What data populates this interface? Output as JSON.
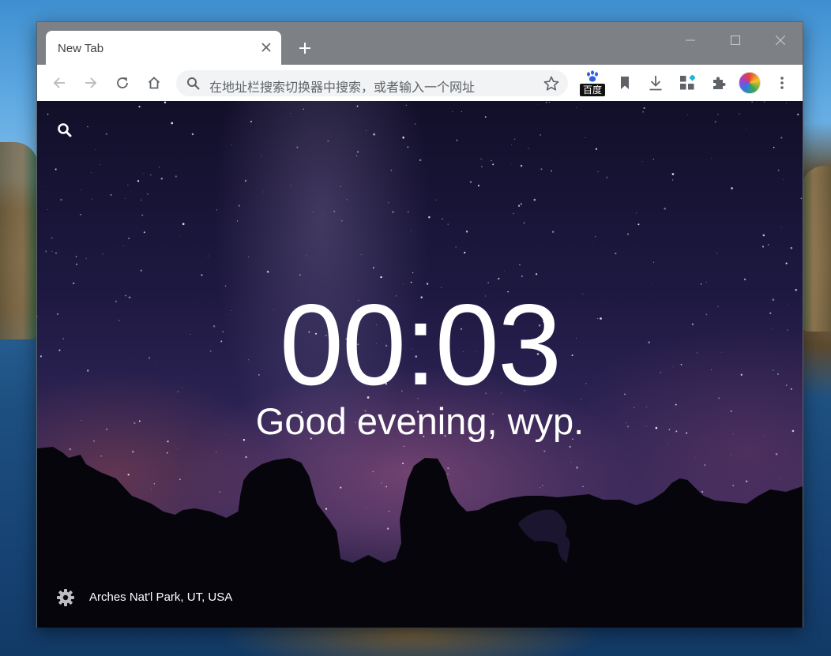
{
  "tab": {
    "title": "New Tab"
  },
  "omnibox": {
    "placeholder": "在地址栏搜索切换器中搜索，或者输入一个网址"
  },
  "extensions": {
    "baidu_label": "百度"
  },
  "page": {
    "clock": "00:03",
    "greeting": "Good evening, wyp.",
    "location": "Arches Nat'l Park, UT, USA"
  },
  "icons": {
    "tab_close": "close-icon",
    "new_tab": "plus-icon",
    "minimize": "minimize-icon",
    "maximize": "maximize-icon",
    "close_window": "close-window-icon",
    "back": "back-arrow-icon",
    "forward": "forward-arrow-icon",
    "reload": "reload-icon",
    "home": "home-icon",
    "search": "search-icon",
    "bookmark_star": "star-icon",
    "bookmark": "bookmark-icon",
    "download": "download-icon",
    "apps": "apps-icon",
    "extensions": "puzzle-icon",
    "menu": "more-vertical-icon",
    "settings": "gear-icon"
  },
  "colors": {
    "titlebar": "#7d8185",
    "toolbar": "#ffffff",
    "omnibox": "#f1f3f4",
    "text_on_page": "#ffffff"
  }
}
